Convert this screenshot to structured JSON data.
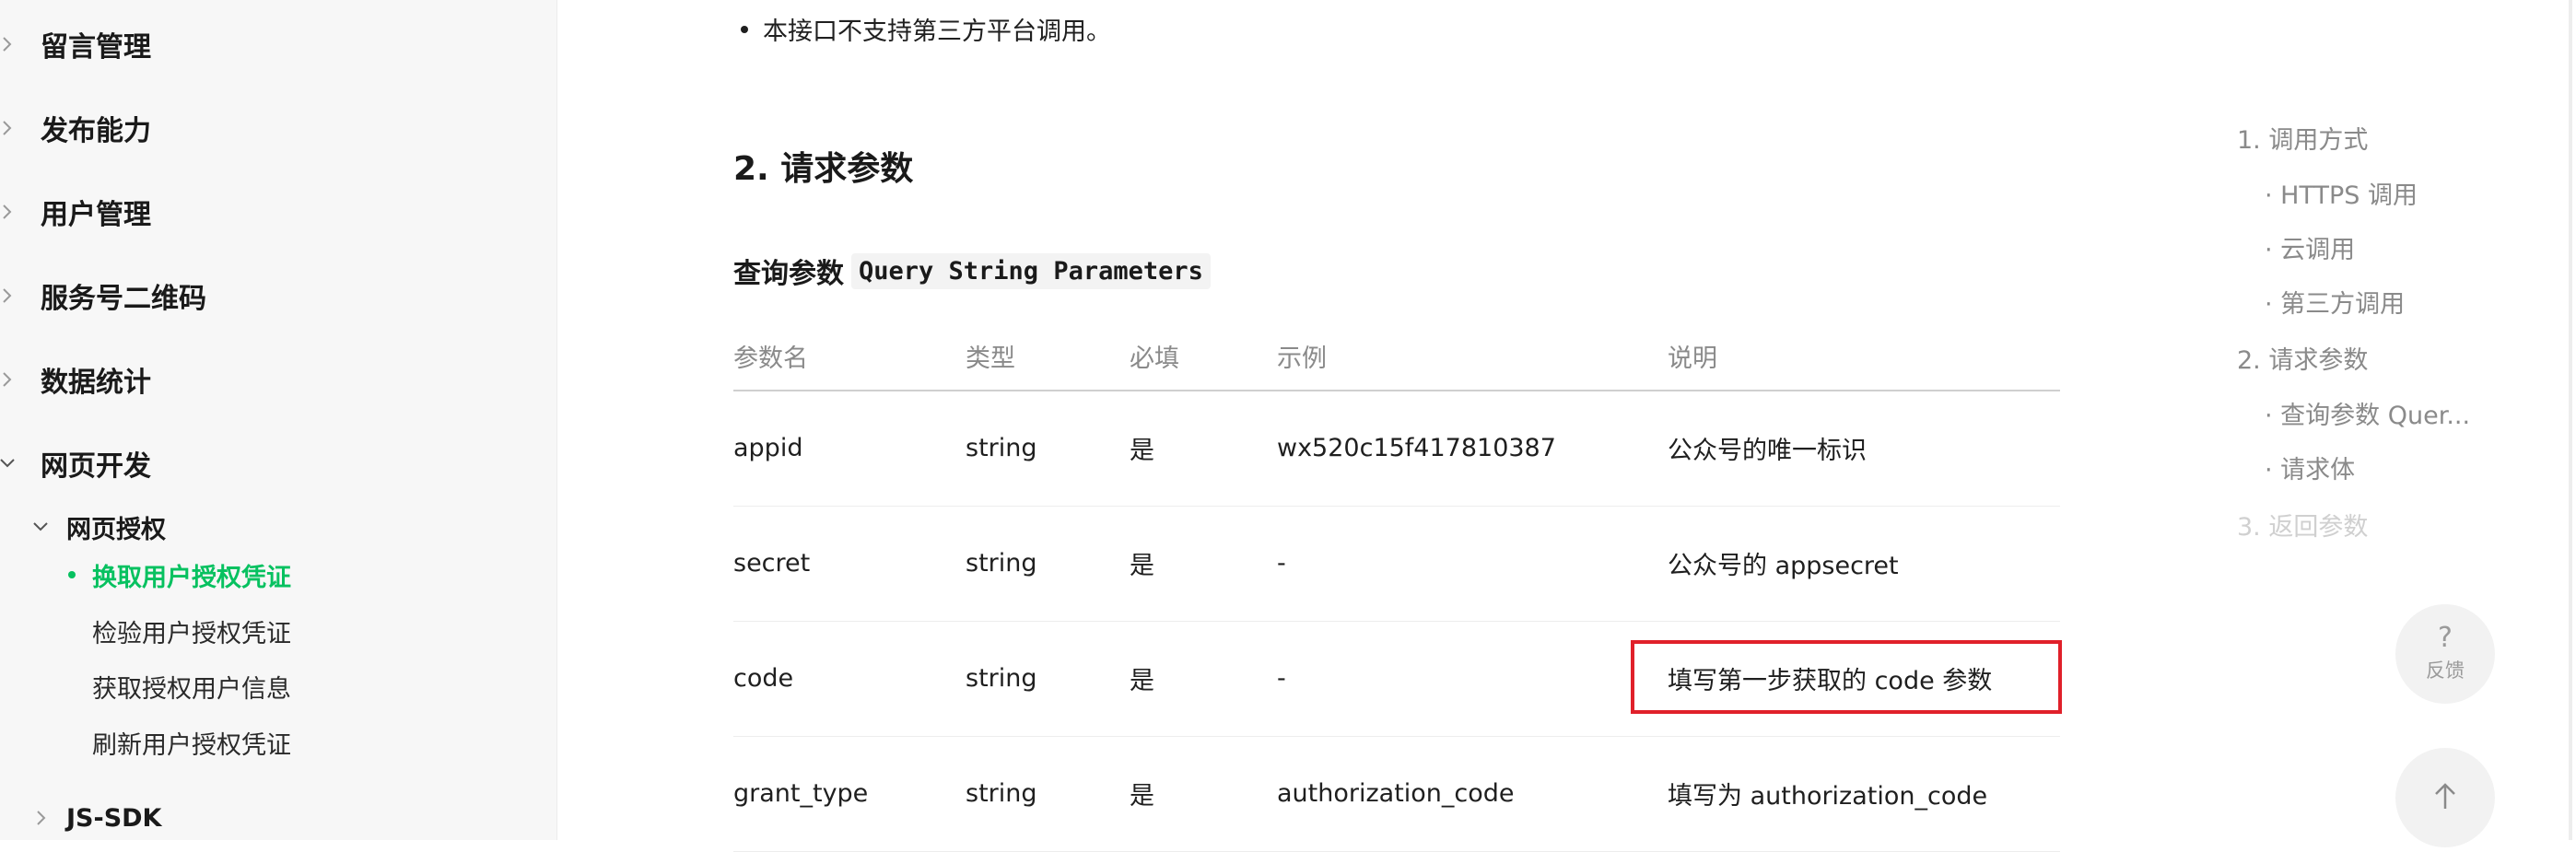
{
  "sidebar": {
    "top_items": [
      {
        "label": "留言管理",
        "expanded": false
      },
      {
        "label": "发布能力",
        "expanded": false
      },
      {
        "label": "用户管理",
        "expanded": false
      },
      {
        "label": "服务号二维码",
        "expanded": false
      },
      {
        "label": "数据统计",
        "expanded": false
      },
      {
        "label": "网页开发",
        "expanded": true
      }
    ],
    "sub_items": [
      {
        "label": "网页授权",
        "expanded": true
      },
      {
        "label": "JS-SDK",
        "expanded": false
      }
    ],
    "leaf_items": [
      {
        "label": "换取用户授权凭证",
        "active": true
      },
      {
        "label": "检验用户授权凭证",
        "active": false
      },
      {
        "label": "获取授权用户信息",
        "active": false
      },
      {
        "label": "刷新用户授权凭证",
        "active": false
      }
    ],
    "accent_color": "#07c160"
  },
  "main": {
    "bullet_text": "本接口不支持第三方平台调用。",
    "section_title": "2. 请求参数",
    "subsection_title_zh": "查询参数",
    "subsection_title_code": "Query String Parameters",
    "table": {
      "headers": [
        "参数名",
        "类型",
        "必填",
        "示例",
        "说明"
      ],
      "rows": [
        [
          "appid",
          "string",
          "是",
          "wx520c15f417810387",
          "公众号的唯一标识"
        ],
        [
          "secret",
          "string",
          "是",
          "-",
          "公众号的 appsecret"
        ],
        [
          "code",
          "string",
          "是",
          "-",
          "填写第一步获取的 code 参数"
        ],
        [
          "grant_type",
          "string",
          "是",
          "authorization_code",
          "填写为 authorization_code"
        ]
      ],
      "highlight_color": "#e0202a"
    }
  },
  "toc": {
    "items": [
      {
        "label": "1. 调用方式",
        "level": 1
      },
      {
        "label": "· HTTPS 调用",
        "level": 2
      },
      {
        "label": "· 云调用",
        "level": 2
      },
      {
        "label": "· 第三方调用",
        "level": 2
      },
      {
        "label": "2. 请求参数",
        "level": 1
      },
      {
        "label": "· 查询参数 Quer...",
        "level": 2
      },
      {
        "label": "· 请求体",
        "level": 2
      },
      {
        "label": "3. 返回参数",
        "level": 1
      }
    ]
  },
  "floating": {
    "feedback_symbol": "?",
    "feedback_label": "反馈",
    "back_to_top_icon": "arrow-up-icon"
  }
}
